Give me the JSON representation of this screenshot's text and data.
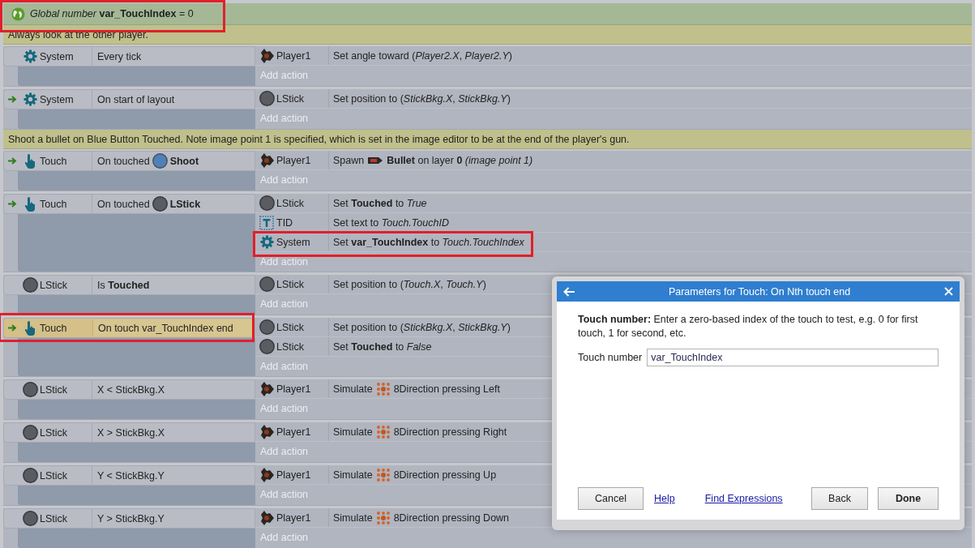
{
  "global_variable": {
    "text": "*Global number* **var_TouchIndex** = 0",
    "highlighted": true
  },
  "items": [
    {
      "kind": "comment",
      "text": "Always look at the other player."
    },
    {
      "kind": "event",
      "trigger": false,
      "conditions": [
        {
          "kind": "system",
          "object": "System",
          "text": "Every tick",
          "selected": false,
          "highlighted": false
        }
      ],
      "actions": [
        {
          "kind": "sprite",
          "object": "Player1",
          "text": "Set angle toward (*Player2.X*, *Player2.Y*)",
          "highlighted": false
        }
      ],
      "add_action": "Add action"
    },
    {
      "kind": "event",
      "trigger": true,
      "conditions": [
        {
          "kind": "system",
          "object": "System",
          "text": "On start of layout",
          "selected": false,
          "highlighted": false
        }
      ],
      "actions": [
        {
          "kind": "circle",
          "object": "LStick",
          "text": "Set position to (*StickBkg.X*, *StickBkg.Y*)",
          "highlighted": false
        }
      ],
      "add_action": "Add action"
    },
    {
      "kind": "comment",
      "text": "Shoot a bullet on Blue Button Touched.  Note image point 1 is specified, which is set in the image editor to be at the end of the player's gun."
    },
    {
      "kind": "event",
      "trigger": true,
      "conditions": [
        {
          "kind": "touch",
          "object": "Touch",
          "segments": [
            {
              "kind": "text",
              "text": "On touched"
            },
            {
              "kind": "ball"
            },
            {
              "kind": "text",
              "text": "**Shoot**"
            }
          ],
          "selected": false,
          "highlighted": false
        }
      ],
      "actions": [
        {
          "kind": "sprite",
          "object": "Player1",
          "segments": [
            {
              "kind": "text",
              "text": "Spawn"
            },
            {
              "kind": "bullet"
            },
            {
              "kind": "text",
              "text": "**Bullet** on layer **0** *(image point 1)*"
            }
          ],
          "highlighted": false
        }
      ],
      "add_action": "Add action"
    },
    {
      "kind": "event",
      "trigger": true,
      "conditions": [
        {
          "kind": "touch",
          "object": "Touch",
          "segments": [
            {
              "kind": "text",
              "text": "On touched"
            },
            {
              "kind": "circle"
            },
            {
              "kind": "text",
              "text": "**LStick**"
            }
          ],
          "selected": false,
          "highlighted": false
        }
      ],
      "actions": [
        {
          "kind": "circle",
          "object": "LStick",
          "text": "Set **Touched** to *True*",
          "highlighted": false
        },
        {
          "kind": "text",
          "object": "TID",
          "text": "Set text to *Touch.TouchID*",
          "highlighted": false
        },
        {
          "kind": "system",
          "object": "System",
          "text": "Set **var_TouchIndex** to *Touch.TouchIndex*",
          "highlighted": true
        }
      ],
      "add_action": "Add action"
    },
    {
      "kind": "event",
      "trigger": false,
      "conditions": [
        {
          "kind": "circle",
          "object": "LStick",
          "text": "Is **Touched**",
          "selected": false,
          "highlighted": false
        }
      ],
      "actions": [
        {
          "kind": "circle",
          "object": "LStick",
          "text": "Set position to (*Touch.X*, *Touch.Y*)",
          "highlighted": false
        }
      ],
      "add_action": "Add action"
    },
    {
      "kind": "event",
      "trigger": true,
      "conditions": [
        {
          "kind": "touch",
          "object": "Touch",
          "text": "On touch var_TouchIndex end",
          "selected": true,
          "highlighted": true
        }
      ],
      "actions": [
        {
          "kind": "circle",
          "object": "LStick",
          "text": "Set position to (*StickBkg.X*, *StickBkg.Y*)",
          "highlighted": false
        },
        {
          "kind": "circle",
          "object": "LStick",
          "text": "Set **Touched** to *False*",
          "highlighted": false
        }
      ],
      "add_action": "Add action"
    },
    {
      "kind": "event",
      "trigger": false,
      "conditions": [
        {
          "kind": "circle",
          "object": "LStick",
          "text": "X < StickBkg.X",
          "selected": false,
          "highlighted": false
        }
      ],
      "actions": [
        {
          "kind": "sprite",
          "object": "Player1",
          "segments": [
            {
              "kind": "text",
              "text": "Simulate"
            },
            {
              "kind": "dpad"
            },
            {
              "kind": "text",
              "text": "8Direction pressing Left"
            }
          ],
          "highlighted": false
        }
      ],
      "add_action": "Add action"
    },
    {
      "kind": "event",
      "trigger": false,
      "conditions": [
        {
          "kind": "circle",
          "object": "LStick",
          "text": "X > StickBkg.X",
          "selected": false,
          "highlighted": false
        }
      ],
      "actions": [
        {
          "kind": "sprite",
          "object": "Player1",
          "segments": [
            {
              "kind": "text",
              "text": "Simulate"
            },
            {
              "kind": "dpad"
            },
            {
              "kind": "text",
              "text": "8Direction pressing Right"
            }
          ],
          "highlighted": false
        }
      ],
      "add_action": "Add action"
    },
    {
      "kind": "event",
      "trigger": false,
      "conditions": [
        {
          "kind": "circle",
          "object": "LStick",
          "text": "Y < StickBkg.Y",
          "selected": false,
          "highlighted": false
        }
      ],
      "actions": [
        {
          "kind": "sprite",
          "object": "Player1",
          "segments": [
            {
              "kind": "text",
              "text": "Simulate"
            },
            {
              "kind": "dpad"
            },
            {
              "kind": "text",
              "text": "8Direction pressing Up"
            }
          ],
          "highlighted": false
        }
      ],
      "add_action": "Add action"
    },
    {
      "kind": "event",
      "trigger": false,
      "conditions": [
        {
          "kind": "circle",
          "object": "LStick",
          "text": "Y > StickBkg.Y",
          "selected": false,
          "highlighted": false
        }
      ],
      "actions": [
        {
          "kind": "sprite",
          "object": "Player1",
          "segments": [
            {
              "kind": "text",
              "text": "Simulate"
            },
            {
              "kind": "dpad"
            },
            {
              "kind": "text",
              "text": "8Direction pressing Down"
            }
          ],
          "highlighted": false
        }
      ],
      "add_action": "Add action"
    }
  ],
  "dialog": {
    "title": "Parameters for Touch: On Nth touch end",
    "description": "**Touch number:** Enter a zero-based index of the touch to test, e.g. 0 for first touch, 1 for second, etc.",
    "field_label": "Touch number",
    "field_value": "var_TouchIndex",
    "buttons": [
      {
        "label": "Cancel",
        "kind": "button",
        "default": false
      },
      {
        "label": "Help",
        "kind": "link"
      },
      {
        "label": "Find Expressions",
        "kind": "link"
      },
      {
        "label": "Back",
        "kind": "button",
        "default": false
      },
      {
        "label": "Done",
        "kind": "button",
        "default": true
      }
    ]
  }
}
